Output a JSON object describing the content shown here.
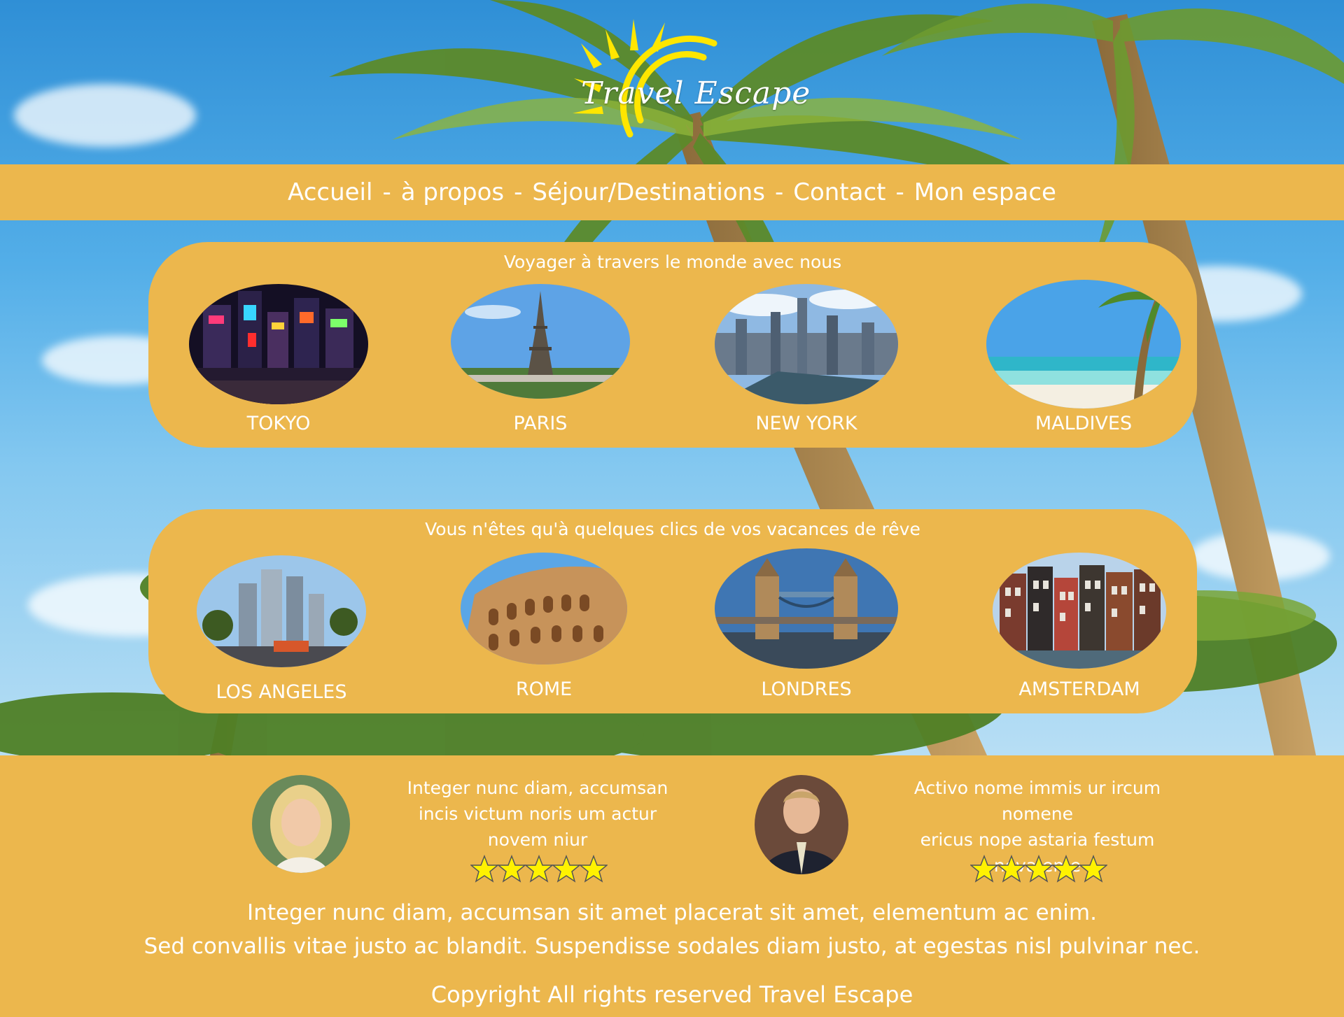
{
  "site": {
    "logo_text": "Travel Escape"
  },
  "nav": {
    "items": [
      "Accueil",
      "à propos",
      "Séjour/Destinations",
      "Contact",
      "Mon espace"
    ],
    "separator": "-"
  },
  "section1": {
    "title": "Voyager à travers le monde avec nous",
    "destinations": [
      "TOKYO",
      "PARIS",
      "NEW YORK",
      "MALDIVES"
    ]
  },
  "section2": {
    "title": "Vous n'êtes qu'à quelques clics de vos vacances de rêve",
    "destinations": [
      "LOS ANGELES",
      "ROME",
      "LONDRES",
      "AMSTERDAM"
    ]
  },
  "reviews": [
    {
      "lines": [
        "Integer nunc diam, accumsan",
        "incis victum noris um actur",
        "novem niur"
      ],
      "rating": 5
    },
    {
      "lines": [
        "Activo nome immis ur ircum nomene",
        "ericus nope astaria festum",
        "nova eme"
      ],
      "rating": 5
    }
  ],
  "footer": {
    "line1": "Integer nunc diam, accumsan sit amet placerat sit amet, elementum ac enim.",
    "line2": "Sed convallis vitae justo ac blandit. Suspendisse sodales diam justo, at egestas nisl pulvinar nec.",
    "copyright": "Copyright All rights reserved Travel Escape"
  },
  "colors": {
    "accent": "#ecb74d",
    "star": "#fff200",
    "sky": "#53aee8"
  },
  "icons": {
    "star": "star-icon"
  }
}
